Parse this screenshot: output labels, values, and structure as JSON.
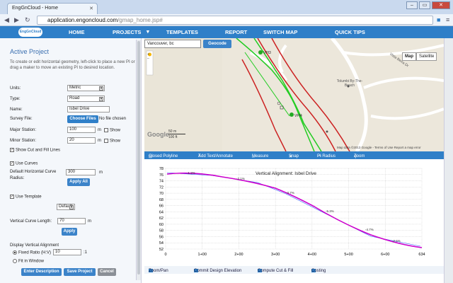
{
  "browser": {
    "tab_title": "EngGnCloud - Home",
    "url_host": "application.engoncloud.com",
    "url_path": "/gmap_home.jsp#"
  },
  "nav": {
    "logo": "EngGnCloud",
    "items": [
      "HOME",
      "PROJECTS",
      "TEMPLATES",
      "REPORT",
      "SWITCH MAP",
      "QUICK TIPS"
    ]
  },
  "panel": {
    "title": "Active Project",
    "help": "To create or edit horizontal geometry, left-click to place a new PI or drag a maker to move an existing PI to desired location.",
    "units_label": "Units:",
    "units_value": "Metric",
    "type_label": "Type:",
    "type_value": "Road",
    "name_label": "Name:",
    "name_value": "Isbel Drive",
    "survey_label": "Survey File:",
    "choose_files": "Choose Files",
    "no_file": "No file chosen",
    "major_label": "Major Station:",
    "major_value": "100",
    "minor_label": "Minor Station:",
    "minor_value": "20",
    "unit_m": "m",
    "show": "Show",
    "cut_fill": "Show Cut and Fill Lines",
    "use_curves": "Use Curves",
    "radius_label_1": "Default Horizontal Curve",
    "radius_label_2": "Radius:",
    "radius_value": "300",
    "apply_all": "Apply All",
    "use_template": "Use Template",
    "template_value": "Default",
    "vcurve_label": "Vertical Curve Length:",
    "vcurve_value": "70",
    "apply": "Apply",
    "display_va": "Display Vertical Alignment",
    "fixed_ratio": "Fixed Ratio (H:V)",
    "ratio_value": "10",
    "ratio_suffix": ":1",
    "fit_window": "Fit in Window",
    "enter_desc": "Enter Description",
    "save_project": "Save Project",
    "cancel": "Cancel"
  },
  "map": {
    "search_value": "Vancouver, bc",
    "geocode": "Geocode",
    "map_btn": "Map",
    "satellite_btn": "Satellite",
    "labels": [
      "Vista Berra Dr",
      "Tolumbi By-The-Beach",
      "VPI3",
      "VPI4"
    ],
    "google": "Google",
    "scale_top": "50 m",
    "scale_bottom": "100 ft",
    "copyright": "Map data ©2013 Google - Terms of Use  Report a map error"
  },
  "toolbar": {
    "items": [
      "Closed Polyline",
      "Add Text/Annotate",
      "Measure",
      "Snap",
      "PI Radius",
      "Zoom"
    ]
  },
  "profile": {
    "title": "Vertical Alignment: Isbel Drive",
    "y_ticks": [
      "78",
      "76",
      "74",
      "72",
      "70",
      "68",
      "66",
      "64",
      "62",
      "60",
      "58",
      "56",
      "54",
      "52"
    ],
    "x_ticks": [
      "0",
      "1+00",
      "2+00",
      "3+00",
      "4+00",
      "5+00",
      "6+00",
      "634"
    ],
    "grade_labels": [
      "-1.2%",
      "-2.1%",
      "-3.7%",
      "-5.3%",
      "-4.7%",
      "-2.6%"
    ]
  },
  "bottom": {
    "items": [
      "Zoom/Pan",
      "Commit Design Elevation",
      "Compute Cut & Fill",
      "Costing"
    ]
  }
}
